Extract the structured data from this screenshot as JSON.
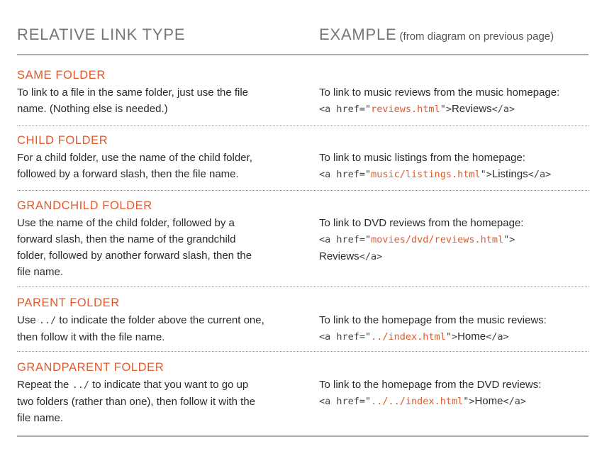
{
  "header": {
    "col1": "RELATIVE LINK TYPE",
    "col2": "EXAMPLE",
    "col2_note": "(from diagram on previous page)"
  },
  "rows": [
    {
      "title": "SAME FOLDER",
      "desc_lines": [
        "To link to a file in the same folder, just use the file",
        "name. (Nothing else is needed.)"
      ],
      "example_intro": "To link to music reviews from the music homepage:",
      "code_open": "<a href=\"",
      "href": "reviews.html",
      "code_mid": "\">",
      "link_text": "Reviews",
      "code_close": "</a>"
    },
    {
      "title": "CHILD FOLDER",
      "desc_lines": [
        "For a child folder, use the name of the child folder,",
        "followed by a forward slash, then the file name."
      ],
      "example_intro": "To link to music listings from the homepage:",
      "code_open": "<a href=\"",
      "href": "music/listings.html",
      "code_mid": "\">",
      "link_text": "Listings",
      "code_close": "</a>"
    },
    {
      "title": "GRANDCHILD FOLDER",
      "desc_lines": [
        "Use the name of the child folder, followed by a",
        "forward slash, then the name of the grandchild",
        "folder, followed by another forward slash, then the",
        "file name."
      ],
      "example_intro": "To link to DVD reviews from the homepage:",
      "code_open": "<a href=\"",
      "href": "movies/dvd/reviews.html",
      "code_mid": "\">",
      "link_text": "Reviews",
      "code_close": "</a>"
    },
    {
      "title": "PARENT FOLDER",
      "desc_1a": "Use ",
      "desc_1code": "../",
      "desc_1b": " to indicate the folder above the current one,",
      "desc_2": "then follow it with the file name.",
      "example_intro": "To link to the homepage from the music reviews:",
      "code_open": "<a href=\"",
      "href": "../index.html",
      "code_mid": "\">",
      "link_text": "Home",
      "code_close": "</a>"
    },
    {
      "title": "GRANDPARENT FOLDER",
      "desc_1a": "Repeat the ",
      "desc_1code": "../",
      "desc_1b": " to indicate that you want to go up",
      "desc_2": "two folders (rather than one), then follow it with the",
      "desc_3": "file name.",
      "example_intro": "To link to the homepage from the DVD reviews:",
      "code_open": "<a href=\"",
      "href": "../../index.html",
      "code_mid": "\">",
      "link_text": "Home",
      "code_close": "</a>"
    }
  ],
  "colors": {
    "accent": "#e05a2b",
    "heading_gray": "#777777",
    "rule_gray": "#aaaaaa",
    "text": "#2a2a2a"
  }
}
